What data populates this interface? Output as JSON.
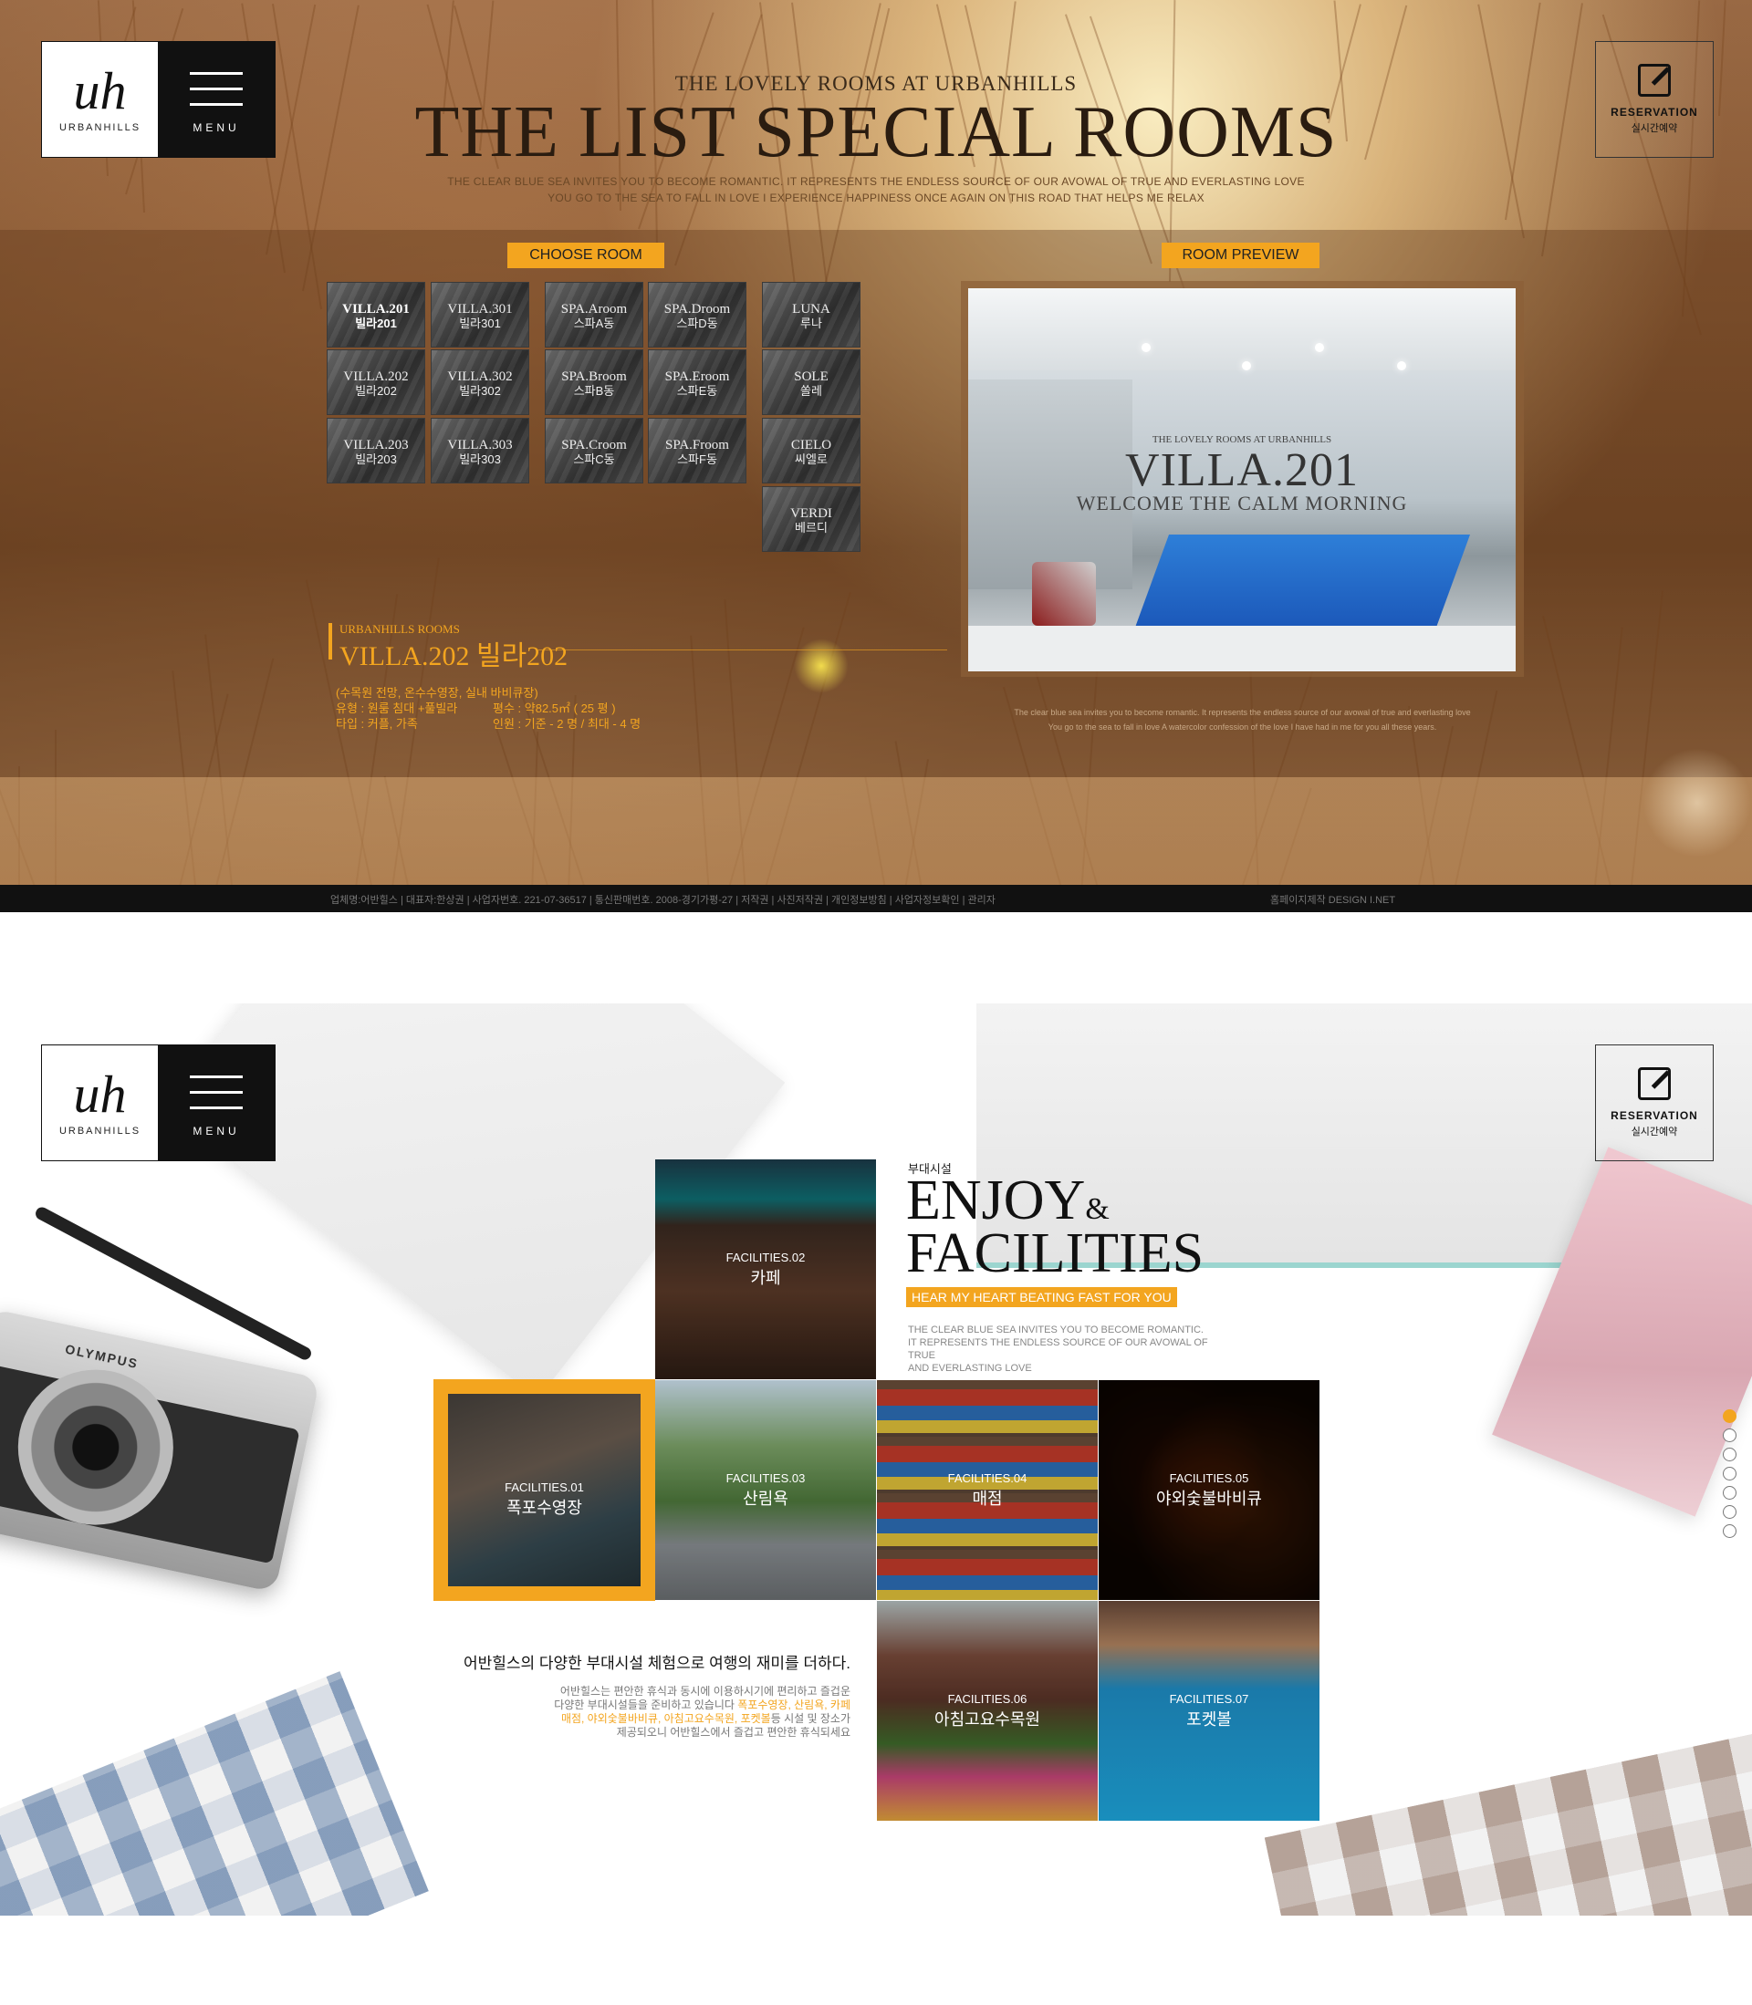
{
  "header": {
    "logo_mark": "uh",
    "logo_name": "URBANHILLS",
    "menu_label": "MENU",
    "reservation_title": "RESERVATION",
    "reservation_subtitle": "실시간예약"
  },
  "rooms_section": {
    "subtitle": "THE LOVELY ROOMS AT URBANHILLS",
    "title": "THE LIST SPECIAL ROOMS",
    "desc_line1": "THE CLEAR BLUE SEA INVITES YOU TO BECOME ROMANTIC. IT REPRESENTS THE ENDLESS SOURCE OF OUR AVOWAL OF TRUE AND EVERLASTING LOVE",
    "desc_line2": "YOU GO TO THE SEA TO FALL IN LOVE I EXPERIENCE HAPPINESS ONCE AGAIN ON THIS ROAD THAT HELPS ME RELAX",
    "choose_room_label": "CHOOSE ROOM",
    "room_preview_label": "ROOM PREVIEW",
    "rooms": [
      {
        "en": "VILLA.201",
        "ko": "빌라201"
      },
      {
        "en": "VILLA.301",
        "ko": "빌라301"
      },
      {
        "en": "SPA.Aroom",
        "ko": "스파A동"
      },
      {
        "en": "SPA.Droom",
        "ko": "스파D동"
      },
      {
        "en": "LUNA",
        "ko": "루나"
      },
      {
        "en": "VILLA.202",
        "ko": "빌라202"
      },
      {
        "en": "VILLA.302",
        "ko": "빌라302"
      },
      {
        "en": "SPA.Broom",
        "ko": "스파B동"
      },
      {
        "en": "SPA.Eroom",
        "ko": "스파E동"
      },
      {
        "en": "SOLE",
        "ko": "쏠레"
      },
      {
        "en": "VILLA.203",
        "ko": "빌라203"
      },
      {
        "en": "VILLA.303",
        "ko": "빌라303"
      },
      {
        "en": "SPA.Croom",
        "ko": "스파C동"
      },
      {
        "en": "SPA.Froom",
        "ko": "스파F동"
      },
      {
        "en": "CIELO",
        "ko": "씨엘로"
      },
      {
        "en": "VERDI",
        "ko": "베르디"
      }
    ],
    "preview": {
      "subtitle": "THE LOVELY ROOMS AT URBANHILLS",
      "title": "VILLA.201",
      "tagline": "WELCOME THE CALM MORNING",
      "desc_line1": "The clear blue sea invites you to become romantic. It represents the endless source of our avowal of true and everlasting love",
      "desc_line2": "You go to the sea to fall in love A watercolor confession of the love I have had in me for you all these years."
    },
    "detail": {
      "label": "URBANHILLS ROOMS",
      "name": "VILLA.202 빌라202",
      "line1": "(수목원 전망, 온수수영장, 실내 바비큐장)",
      "line2a": "유형 : 원룸 침대 +풀빌라",
      "line2b": "평수 : 약82.5㎡ ( 25 평 )",
      "line3a": "타입 : 커플, 가족",
      "line3b": "인원 : 기준 - 2 명 / 최대 - 4 명"
    }
  },
  "footer": {
    "left": "업체명:어반힐스  |  대표자:한상권  |  사업자번호. 221-07-36517  |  통신판매번호. 2008-경기가평-27  |  저작권  |  사진저작권  |  개인정보방침  |  사업자정보확인  |  관리자",
    "right": "홈페이지제작 DESIGN I.NET"
  },
  "facilities_section": {
    "small_label": "부대시설",
    "title_word1": "ENJOY",
    "title_amp": "&",
    "title_word2": "FACILITIES",
    "tagline": "HEAR MY HEART BEATING FAST FOR YOU",
    "desc_line1": "THE CLEAR BLUE SEA INVITES YOU TO BECOME ROMANTIC.",
    "desc_line2": "IT REPRESENTS THE ENDLESS SOURCE OF OUR AVOWAL OF TRUE",
    "desc_line3": "AND EVERLASTING LOVE",
    "items": [
      {
        "num": "FACILITIES.01",
        "name": "폭포수영장"
      },
      {
        "num": "FACILITIES.02",
        "name": "카페"
      },
      {
        "num": "FACILITIES.03",
        "name": "산림욕"
      },
      {
        "num": "FACILITIES.04",
        "name": "매점"
      },
      {
        "num": "FACILITIES.05",
        "name": "야외숯불바비큐"
      },
      {
        "num": "FACILITIES.06",
        "name": "아침고요수목원"
      },
      {
        "num": "FACILITIES.07",
        "name": "포켓볼"
      }
    ],
    "intro": "어반힐스의 다양한 부대시설 체험으로 여행의 재미를 더하다.",
    "body_part1": "어반힐스는 편안한 휴식과 동시에 이용하시기에 편리하고 즐겁운",
    "body_part2": "다양한 부대시설들을 준비하고 있습니다 ",
    "body_hl1": "폭포수영장, 산림욕, 카페",
    "body_hl2": "매점, 야외숯불바비큐, 아침고요수목원, 포켓볼",
    "body_part3": "등 시설 및 장소가",
    "body_part4": "제공되오니 어반힐스에서 즐겁고 편안한 휴식되세요",
    "camera_brand": "OLYMPUS"
  },
  "pagination": {
    "count": 7,
    "active": 1
  },
  "colors": {
    "accent": "#f3a51f",
    "dark": "#111111"
  }
}
